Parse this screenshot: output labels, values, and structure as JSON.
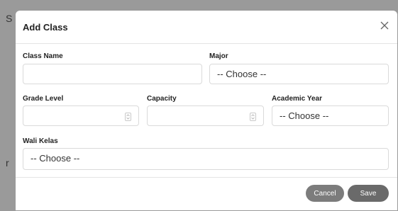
{
  "backdrop": {
    "left_letter": "S",
    "lower_letter": "r"
  },
  "modal": {
    "title": "Add Class",
    "fields": {
      "class_name": {
        "label": "Class Name",
        "value": ""
      },
      "major": {
        "label": "Major",
        "selected": "-- Choose --"
      },
      "grade_level": {
        "label": "Grade Level",
        "value": ""
      },
      "capacity": {
        "label": "Capacity",
        "value": ""
      },
      "academic_year": {
        "label": "Academic Year",
        "selected": "-- Choose --"
      },
      "wali_kelas": {
        "label": "Wali Kelas",
        "selected": "-- Choose --"
      }
    },
    "buttons": {
      "cancel": "Cancel",
      "save": "Save"
    },
    "icons": {
      "close": "close-icon",
      "spinner": "number-spinner-icon"
    }
  }
}
